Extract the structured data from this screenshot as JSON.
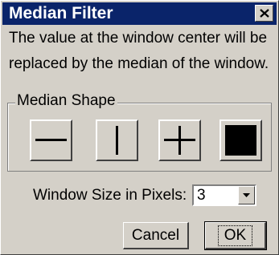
{
  "window": {
    "title": "Median Filter",
    "close_icon": "close-icon"
  },
  "description": {
    "line1": "The value at the window center will be",
    "line2": "replaced by the median of the window."
  },
  "shape_group": {
    "label": "Median Shape",
    "buttons": [
      {
        "name": "horizontal-line-icon"
      },
      {
        "name": "vertical-line-icon"
      },
      {
        "name": "plus-icon"
      },
      {
        "name": "filled-square-icon"
      }
    ]
  },
  "window_size": {
    "label": "Window Size in Pixels:",
    "value": "3"
  },
  "actions": {
    "cancel_label": "Cancel",
    "ok_label": "OK"
  },
  "colors": {
    "titlebar": "#0a246a",
    "face": "#d4d0c8"
  }
}
